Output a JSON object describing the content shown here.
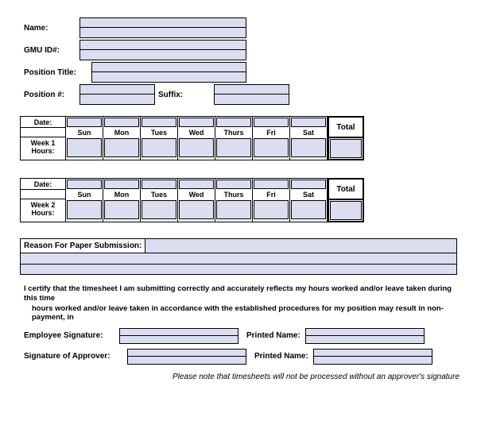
{
  "header": {
    "name_label": "Name:",
    "gmu_label": "GMU ID#:",
    "position_title_label": "Position Title:",
    "position_num_label": "Position #:",
    "suffix_label": "Suffix:"
  },
  "days": [
    "Sun",
    "Mon",
    "Tues",
    "Wed",
    "Thurs",
    "Fri",
    "Sat"
  ],
  "week1": {
    "date_label": "Date:",
    "hours_label_a": "Week 1",
    "hours_label_b": "Hours:",
    "total_label": "Total"
  },
  "week2": {
    "date_label": "Date:",
    "hours_label_a": "Week 2",
    "hours_label_b": "Hours:",
    "total_label": "Total"
  },
  "reason_label": "Reason For Paper Submission:",
  "cert_line1": "I certify that the timesheet I am submitting correctly and accurately reflects my hours worked and/or leave taken during this time",
  "cert_line2": "hours worked and/or leave taken in accordance with the established procedures for my position may result in non-payment, in",
  "sig": {
    "emp_label": "Employee Signature:",
    "approver_label": "Signature of Approver:",
    "printed_label": "Printed Name:"
  },
  "footnote": "Please note that timesheets will not be processed without an approver's signature"
}
